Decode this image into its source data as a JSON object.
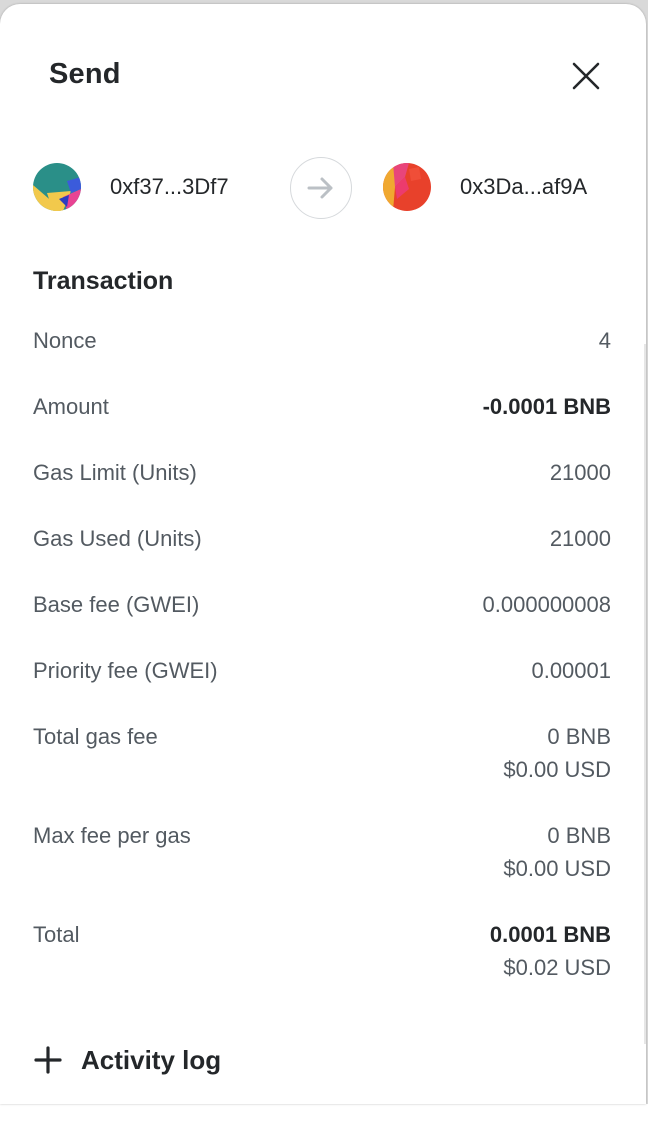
{
  "header": {
    "title": "Send",
    "close_icon": "close-icon"
  },
  "parties": {
    "from_address": "0xf37...3Df7",
    "to_address": "0x3Da...af9A",
    "arrow_icon": "arrow-right-icon"
  },
  "transaction": {
    "section_title": "Transaction",
    "rows": [
      {
        "label": "Nonce",
        "value": "4"
      },
      {
        "label": "Amount",
        "value": "-0.0001 BNB"
      },
      {
        "label": "Gas Limit (Units)",
        "value": "21000"
      },
      {
        "label": "Gas Used (Units)",
        "value": "21000"
      },
      {
        "label": "Base fee (GWEI)",
        "value": "0.000000008"
      },
      {
        "label": "Priority fee (GWEI)",
        "value": "0.00001"
      },
      {
        "label": "Total gas fee",
        "value": "0 BNB",
        "secondary": "$0.00 USD"
      },
      {
        "label": "Max fee per gas",
        "value": "0 BNB",
        "secondary": "$0.00 USD"
      },
      {
        "label": "Total",
        "value": "0.0001 BNB",
        "secondary": "$0.02 USD"
      }
    ]
  },
  "activity": {
    "label": "Activity log",
    "icon": "plus-icon"
  },
  "colors": {
    "text_primary": "#24272a",
    "text_secondary": "#535a61",
    "border": "#d6d9dc"
  }
}
